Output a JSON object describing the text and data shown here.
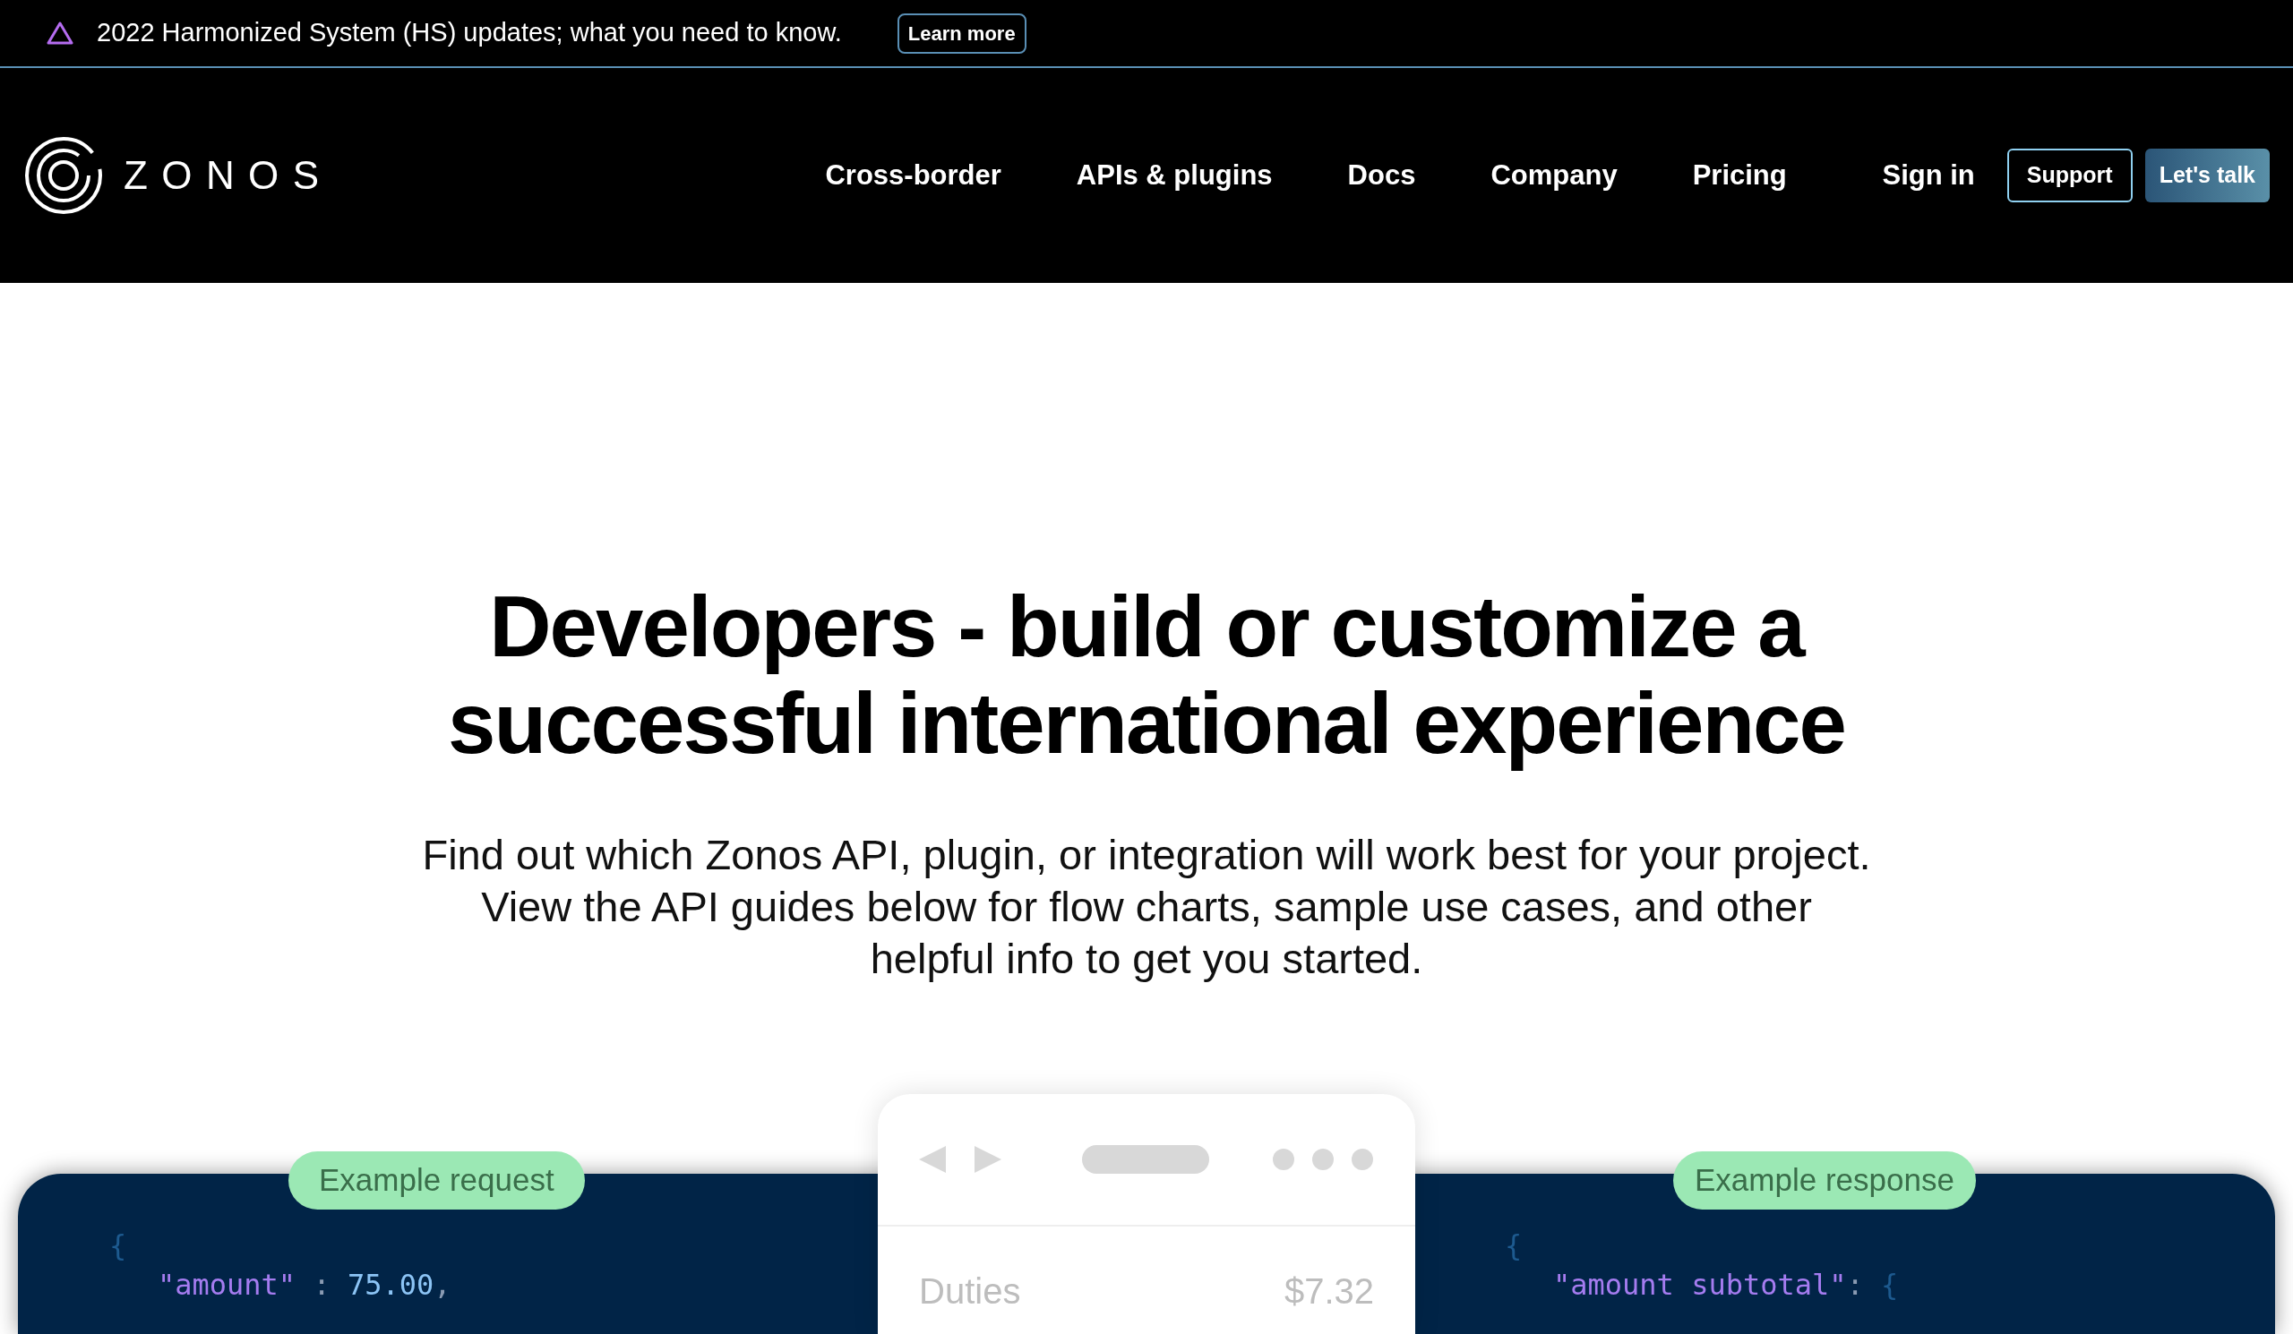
{
  "announcement": {
    "text": "2022 Harmonized System (HS) updates; what you need to know.",
    "button": "Learn more"
  },
  "nav": {
    "logo": "ZONOS",
    "links": [
      "Cross-border",
      "APIs & plugins",
      "Docs",
      "Company",
      "Pricing"
    ],
    "sign_in": "Sign in",
    "support": "Support",
    "cta": "Let's talk"
  },
  "hero": {
    "title": "Developers - build or customize a successful international experience",
    "subtitle": "Find out which Zonos API, plugin, or integration will work best for your project. View the API guides below for flow charts, sample use cases, and other helpful info to get you started."
  },
  "request": {
    "badge": "Example request",
    "lines": [
      {
        "tokens": [
          {
            "kind": "brace",
            "text": "{"
          }
        ]
      },
      {
        "tokens": [
          {
            "kind": "key",
            "text": "\"amount\""
          },
          {
            "kind": "punct",
            "text": " : "
          },
          {
            "kind": "number",
            "text": "75.00"
          },
          {
            "kind": "punct",
            "text": ","
          }
        ]
      }
    ]
  },
  "preview": {
    "label": "Duties",
    "value": "$7.32"
  },
  "response": {
    "badge": "Example response",
    "lines": [
      {
        "tokens": [
          {
            "kind": "brace",
            "text": "{"
          }
        ]
      },
      {
        "tokens": [
          {
            "kind": "key",
            "text": "\"amount subtotal\""
          },
          {
            "kind": "punct",
            "text": ": "
          },
          {
            "kind": "brace",
            "text": "{"
          }
        ]
      }
    ]
  }
}
